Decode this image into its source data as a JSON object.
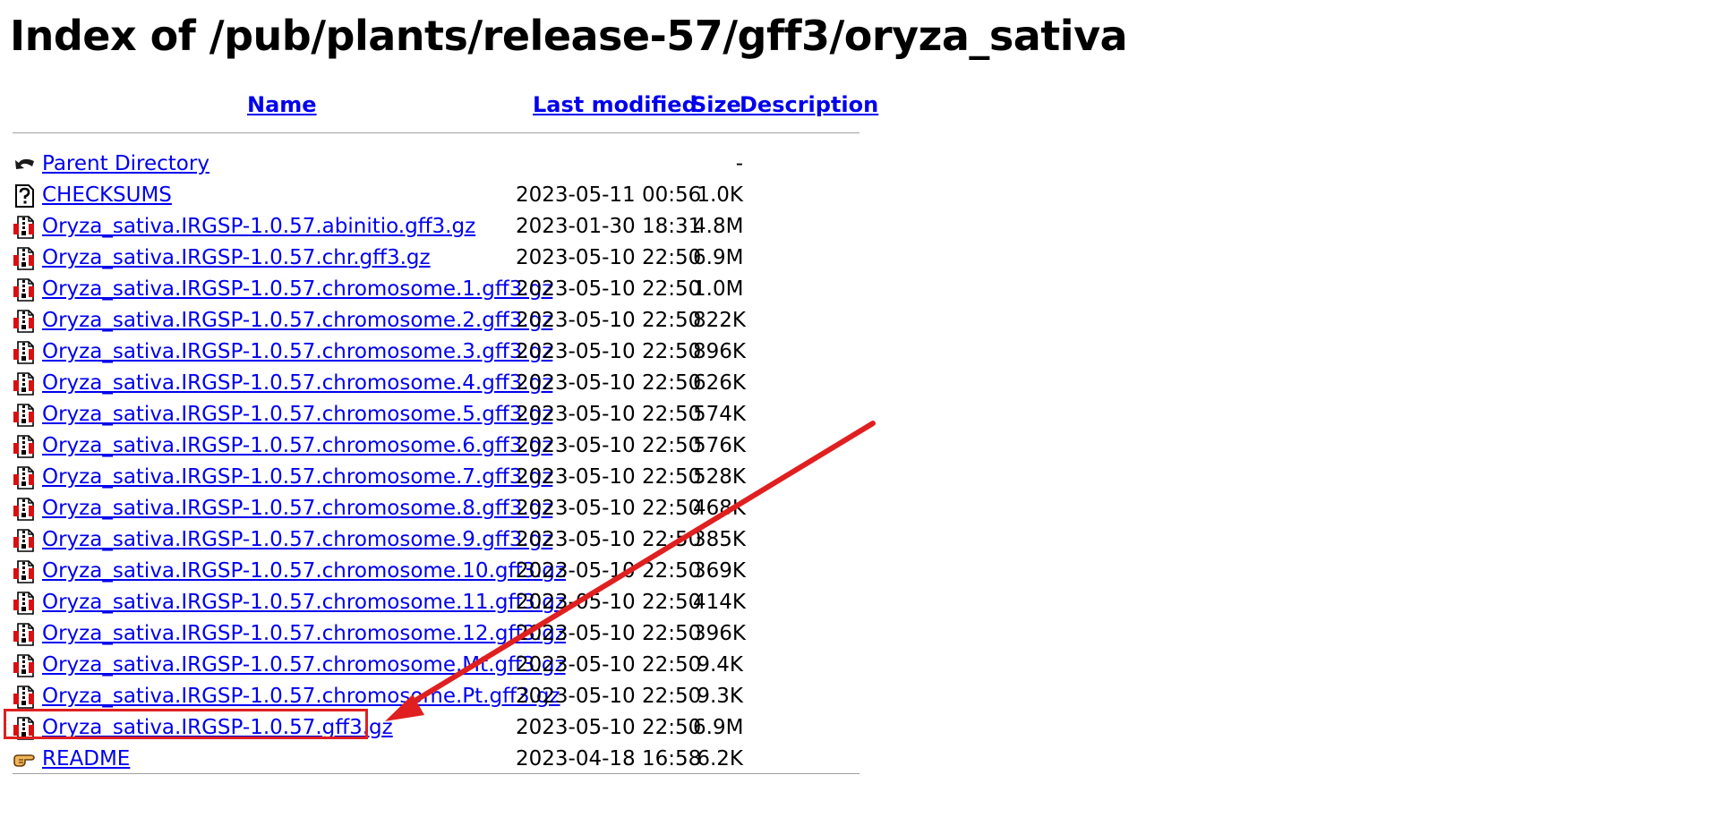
{
  "title": "Index of /pub/plants/release-57/gff3/oryza_sativa",
  "columns": {
    "name": "Name",
    "last_modified": "Last modified",
    "size": "Size",
    "description": "Description"
  },
  "rows": [
    {
      "icon": "back-icon",
      "name": "Parent Directory",
      "date": "",
      "size": "-"
    },
    {
      "icon": "unknown-file-icon",
      "name": "CHECKSUMS",
      "date": "2023-05-11 00:56",
      "size": "1.0K"
    },
    {
      "icon": "compressed-file-icon",
      "name": "Oryza_sativa.IRGSP-1.0.57.abinitio.gff3.gz",
      "date": "2023-01-30 18:31",
      "size": "4.8M"
    },
    {
      "icon": "compressed-file-icon",
      "name": "Oryza_sativa.IRGSP-1.0.57.chr.gff3.gz",
      "date": "2023-05-10 22:50",
      "size": "6.9M"
    },
    {
      "icon": "compressed-file-icon",
      "name": "Oryza_sativa.IRGSP-1.0.57.chromosome.1.gff3.gz",
      "date": "2023-05-10 22:50",
      "size": "1.0M"
    },
    {
      "icon": "compressed-file-icon",
      "name": "Oryza_sativa.IRGSP-1.0.57.chromosome.2.gff3.gz",
      "date": "2023-05-10 22:50",
      "size": "822K"
    },
    {
      "icon": "compressed-file-icon",
      "name": "Oryza_sativa.IRGSP-1.0.57.chromosome.3.gff3.gz",
      "date": "2023-05-10 22:50",
      "size": "896K"
    },
    {
      "icon": "compressed-file-icon",
      "name": "Oryza_sativa.IRGSP-1.0.57.chromosome.4.gff3.gz",
      "date": "2023-05-10 22:50",
      "size": "626K"
    },
    {
      "icon": "compressed-file-icon",
      "name": "Oryza_sativa.IRGSP-1.0.57.chromosome.5.gff3.gz",
      "date": "2023-05-10 22:50",
      "size": "574K"
    },
    {
      "icon": "compressed-file-icon",
      "name": "Oryza_sativa.IRGSP-1.0.57.chromosome.6.gff3.gz",
      "date": "2023-05-10 22:50",
      "size": "576K"
    },
    {
      "icon": "compressed-file-icon",
      "name": "Oryza_sativa.IRGSP-1.0.57.chromosome.7.gff3.gz",
      "date": "2023-05-10 22:50",
      "size": "528K"
    },
    {
      "icon": "compressed-file-icon",
      "name": "Oryza_sativa.IRGSP-1.0.57.chromosome.8.gff3.gz",
      "date": "2023-05-10 22:50",
      "size": "468K"
    },
    {
      "icon": "compressed-file-icon",
      "name": "Oryza_sativa.IRGSP-1.0.57.chromosome.9.gff3.gz",
      "date": "2023-05-10 22:50",
      "size": "385K"
    },
    {
      "icon": "compressed-file-icon",
      "name": "Oryza_sativa.IRGSP-1.0.57.chromosome.10.gff3.gz",
      "date": "2023-05-10 22:50",
      "size": "369K"
    },
    {
      "icon": "compressed-file-icon",
      "name": "Oryza_sativa.IRGSP-1.0.57.chromosome.11.gff3.gz",
      "date": "2023-05-10 22:50",
      "size": "414K"
    },
    {
      "icon": "compressed-file-icon",
      "name": "Oryza_sativa.IRGSP-1.0.57.chromosome.12.gff3.gz",
      "date": "2023-05-10 22:50",
      "size": "396K"
    },
    {
      "icon": "compressed-file-icon",
      "name": "Oryza_sativa.IRGSP-1.0.57.chromosome.Mt.gff3.gz",
      "date": "2023-05-10 22:50",
      "size": "9.4K"
    },
    {
      "icon": "compressed-file-icon",
      "name": "Oryza_sativa.IRGSP-1.0.57.chromosome.Pt.gff3.gz",
      "date": "2023-05-10 22:50",
      "size": "9.3K"
    },
    {
      "icon": "compressed-file-icon",
      "name": "Oryza_sativa.IRGSP-1.0.57.gff3.gz",
      "date": "2023-05-10 22:50",
      "size": "6.9M"
    },
    {
      "icon": "hand-pointer-icon",
      "name": "README",
      "date": "2023-04-18 16:58",
      "size": "6.2K"
    }
  ],
  "annotation": {
    "highlight_color": "#e02020",
    "highlighted_row": "Oryza_sativa.IRGSP-1.0.57.gff3.gz"
  },
  "colors": {
    "link": "#0000ee",
    "rule": "#a0a0a0",
    "annotation": "#e02020"
  }
}
